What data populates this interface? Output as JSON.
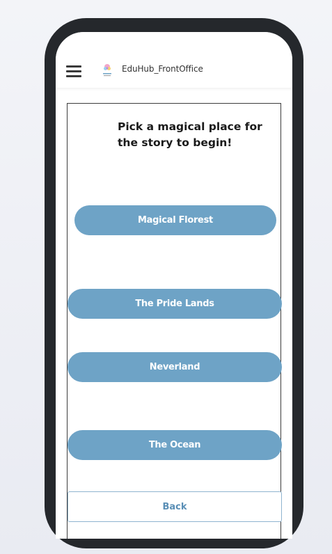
{
  "app": {
    "title": "EduHub_FrontOffice",
    "logo_icon": "eduhub-logo-icon",
    "menu_icon": "hamburger-menu-icon"
  },
  "story": {
    "prompt": "Pick a magical place for the story to begin!",
    "choices": [
      {
        "label": "Magical Florest"
      },
      {
        "label": "The Pride Lands"
      },
      {
        "label": "Neverland"
      },
      {
        "label": "The Ocean"
      }
    ],
    "back_label": "Back"
  },
  "colors": {
    "button_fill": "#6ea3c6",
    "button_text": "#ffffff",
    "back_text": "#5a8fb6",
    "phone_frame": "#25282c"
  }
}
